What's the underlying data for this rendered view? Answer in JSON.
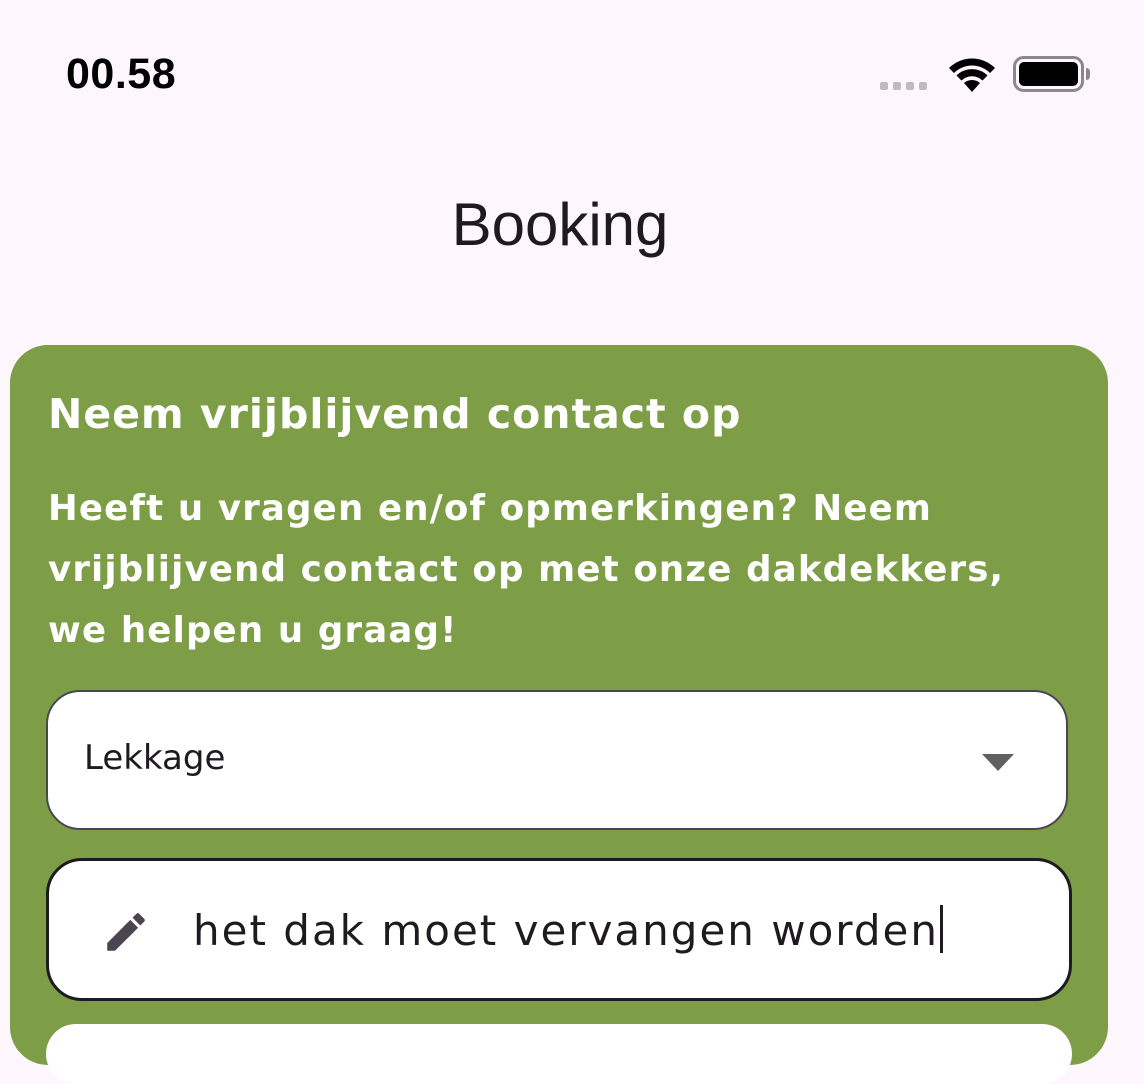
{
  "status_bar": {
    "time": "00.58"
  },
  "header": {
    "title": "Booking"
  },
  "contact_card": {
    "title": "Neem vrijblijvend contact op",
    "description": "Heeft u vragen en/of opmerkingen? Neem vrijblijvend contact op met onze dakdekkers, we helpen u graag!",
    "background_color": "#7d9e47"
  },
  "form": {
    "category_select": {
      "selected": "Lekkage",
      "icon": "chevron-down-icon"
    },
    "message_input": {
      "value": "het dak moet vervangen worden",
      "icon": "pencil-icon"
    }
  }
}
